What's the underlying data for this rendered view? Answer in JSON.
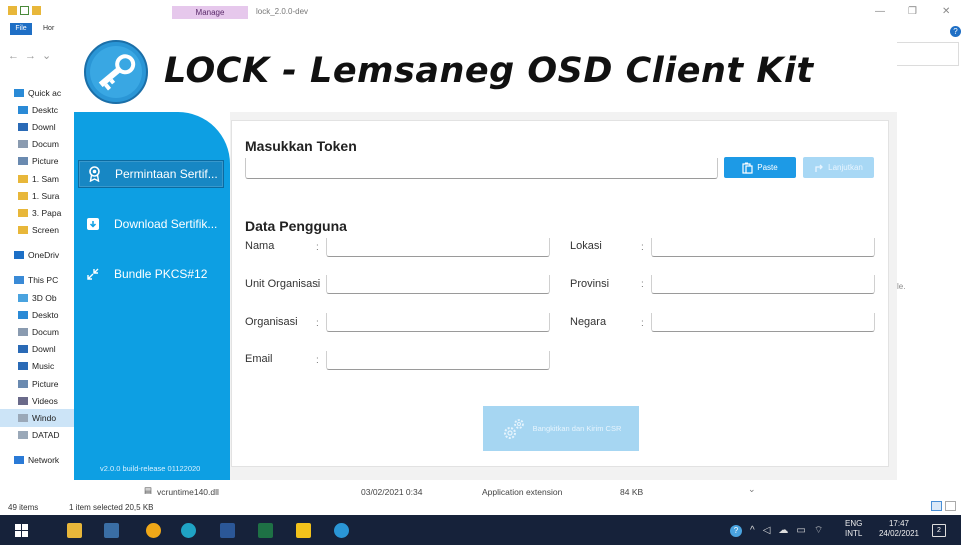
{
  "explorer": {
    "manage_tab": "Manage",
    "window_title": "lock_2.0.0-dev",
    "ribbon": {
      "file": "File",
      "home": "Hor"
    },
    "nav": [
      {
        "label": "Quick ac",
        "icon": "star-icon",
        "top": true
      },
      {
        "label": "Desktc",
        "icon": "desktop-folder-icon"
      },
      {
        "label": "Downl",
        "icon": "download-folder-icon"
      },
      {
        "label": "Docum",
        "icon": "documents-folder-icon"
      },
      {
        "label": "Picture",
        "icon": "pictures-folder-icon"
      },
      {
        "label": "1. Sam",
        "icon": "folder-icon"
      },
      {
        "label": "1. Sura",
        "icon": "folder-icon"
      },
      {
        "label": "3. Papa",
        "icon": "folder-icon"
      },
      {
        "label": "Screen",
        "icon": "folder-icon"
      },
      {
        "label": "OneDriv",
        "icon": "onedrive-icon",
        "top": true
      },
      {
        "label": "This PC",
        "icon": "pc-icon",
        "top": true
      },
      {
        "label": "3D Ob",
        "icon": "3d-objects-icon"
      },
      {
        "label": "Deskto",
        "icon": "desktop-folder-icon"
      },
      {
        "label": "Docum",
        "icon": "documents-folder-icon"
      },
      {
        "label": "Downl",
        "icon": "download-folder-icon"
      },
      {
        "label": "Music",
        "icon": "music-icon"
      },
      {
        "label": "Picture",
        "icon": "pictures-folder-icon"
      },
      {
        "label": "Videos",
        "icon": "videos-icon"
      },
      {
        "label": "Windo",
        "icon": "drive-icon",
        "selected": true
      },
      {
        "label": "DATAD",
        "icon": "drive-icon"
      },
      {
        "label": "Network",
        "icon": "network-icon",
        "top": true
      }
    ],
    "file_row": {
      "name": "vcruntime140.dll",
      "date": "03/02/2021 0:34",
      "type": "Application extension",
      "size": "84 KB"
    },
    "hint": "le.",
    "status": {
      "items": "49 items",
      "selected": "1 item selected  20,5 KB"
    }
  },
  "app": {
    "title": "LOCK - Lemsaneg OSD Client Kit",
    "sidebar": {
      "items": [
        {
          "label": "Permintaan Sertif...",
          "icon": "certificate-request-icon",
          "active": true
        },
        {
          "label": "Download Sertifik...",
          "icon": "download-certificate-icon"
        },
        {
          "label": "Bundle PKCS#12",
          "icon": "bundle-arrows-icon"
        }
      ],
      "version": "v2.0.0 build-release 01122020"
    },
    "token": {
      "title": "Masukkan Token",
      "value": "",
      "paste_label": "Paste",
      "next_label": "Lanjutkan"
    },
    "user": {
      "title": "Data Pengguna",
      "fields": {
        "nama": {
          "label": "Nama",
          "value": ""
        },
        "lokasi": {
          "label": "Lokasi",
          "value": ""
        },
        "unit": {
          "label": "Unit Organisasi",
          "value": ""
        },
        "provinsi": {
          "label": "Provinsi",
          "value": ""
        },
        "organisasi": {
          "label": "Organisasi",
          "value": ""
        },
        "negara": {
          "label": "Negara",
          "value": ""
        },
        "email": {
          "label": "Email",
          "value": ""
        }
      },
      "colon": ":"
    },
    "submit_label": "Bangkitkan dan Kirim CSR"
  },
  "taskbar": {
    "lang": "ENG",
    "lang_sub": "INTL",
    "time": "17:47",
    "date": "24/02/2021",
    "notifications": "2"
  },
  "colors": {
    "sidebar": "#0d9fe3",
    "primary_button": "#1d9ae6",
    "disabled_button": "#a8d8f5",
    "taskbar": "#16223a"
  }
}
